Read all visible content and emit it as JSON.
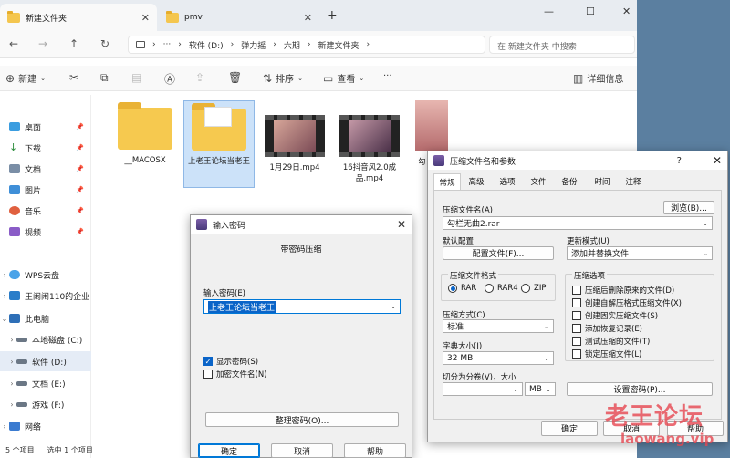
{
  "explorer": {
    "tabs": [
      {
        "label": "新建文件夹"
      },
      {
        "label": "pmv"
      }
    ],
    "new_tab": "+",
    "window_controls": {
      "minimize": "—",
      "maximize": "☐",
      "close": "✕"
    },
    "nav": {
      "back": "←",
      "forward": "→",
      "up": "↑",
      "refresh": "↻"
    },
    "breadcrumb": [
      "软件 (D:)",
      "弹力摇",
      "六期",
      "新建文件夹"
    ],
    "breadcrumb_more": "···",
    "search_placeholder": "在 新建文件夹 中搜索",
    "toolbar": {
      "new": "新建",
      "sort": "排序",
      "view": "查看",
      "more": "···",
      "details": "详细信息"
    },
    "sidebar": [
      {
        "label": "桌面",
        "pinned": true
      },
      {
        "label": "下载",
        "pinned": true
      },
      {
        "label": "文档",
        "pinned": true
      },
      {
        "label": "图片",
        "pinned": true
      },
      {
        "label": "音乐",
        "pinned": true
      },
      {
        "label": "视频",
        "pinned": true
      },
      {
        "label": "WPS云盘"
      },
      {
        "label": "王闹闹110的企业"
      },
      {
        "label": "此电脑"
      },
      {
        "label": "本地磁盘 (C:)"
      },
      {
        "label": "软件 (D:)"
      },
      {
        "label": "文档 (E:)"
      },
      {
        "label": "游戏 (F:)"
      },
      {
        "label": "网络"
      }
    ],
    "files": [
      {
        "name": "__MACOSX",
        "type": "folder"
      },
      {
        "name": "上老王论坛当老王",
        "type": "folder"
      },
      {
        "name": "1月29日.mp4",
        "type": "video"
      },
      {
        "name": "16抖音风2.0成品.mp4",
        "type": "video"
      },
      {
        "name": "勾",
        "type": "image"
      }
    ],
    "status": {
      "count": "5 个项目",
      "selected": "选中 1 个项目"
    }
  },
  "password_dialog": {
    "title": "输入密码",
    "heading": "带密码压缩",
    "input_label": "输入密码(E)",
    "input_value": "上老王论坛当老王",
    "show_password": "显示密码(S)",
    "encrypt_names": "加密文件名(N)",
    "manage_button": "整理密码(O)...",
    "ok": "确定",
    "cancel": "取消",
    "help": "帮助"
  },
  "archive_dialog": {
    "title": "压缩文件名和参数",
    "help_mark": "?",
    "tabs": [
      "常规",
      "高级",
      "选项",
      "文件",
      "备份",
      "时间",
      "注释"
    ],
    "archive_name_label": "压缩文件名(A)",
    "browse_button": "浏览(B)...",
    "archive_name_value": "勾栏无曲2.rar",
    "default_profile_label": "默认配置",
    "profile_button": "配置文件(F)...",
    "update_mode_label": "更新模式(U)",
    "update_mode_value": "添加并替换文件",
    "format_label": "压缩文件格式",
    "formats": [
      {
        "label": "RAR",
        "selected": true
      },
      {
        "label": "RAR4",
        "selected": false
      },
      {
        "label": "ZIP",
        "selected": false
      }
    ],
    "options_label": "压缩选项",
    "options": [
      "压缩后删除原来的文件(D)",
      "创建自解压格式压缩文件(X)",
      "创建固实压缩文件(S)",
      "添加恢复记录(E)",
      "测试压缩的文件(T)",
      "锁定压缩文件(L)"
    ],
    "method_label": "压缩方式(C)",
    "method_value": "标准",
    "dict_label": "字典大小(I)",
    "dict_value": "32 MB",
    "split_label": "切分为分卷(V)，大小",
    "split_unit": "MB",
    "set_password_button": "设置密码(P)...",
    "ok": "确定",
    "cancel": "取消",
    "help": "帮助"
  },
  "watermark": {
    "text": "老王论坛",
    "url": "laowang.vip"
  }
}
